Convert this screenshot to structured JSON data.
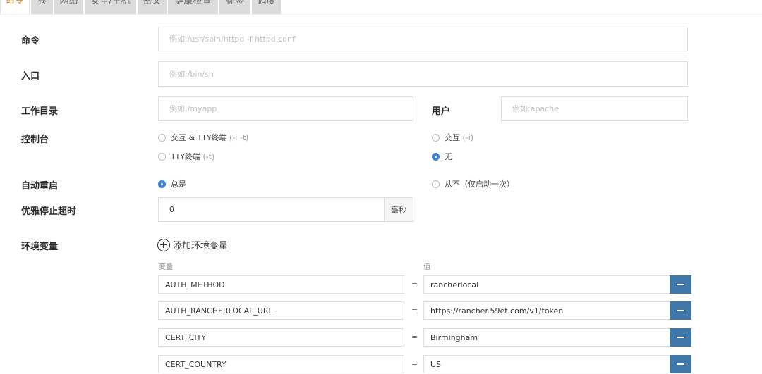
{
  "tabs": [
    {
      "label": "命令",
      "active": true
    },
    {
      "label": "卷",
      "active": false
    },
    {
      "label": "网络",
      "active": false
    },
    {
      "label": "安全/主机",
      "active": false
    },
    {
      "label": "密文",
      "active": false
    },
    {
      "label": "健康检查",
      "active": false
    },
    {
      "label": "标签",
      "active": false
    },
    {
      "label": "调度",
      "active": false
    }
  ],
  "command": {
    "label": "命令",
    "placeholder": "例如:/usr/sbin/httpd -f httpd.conf",
    "value": ""
  },
  "entrypoint": {
    "label": "入口",
    "placeholder": "例如:/bin/sh",
    "value": ""
  },
  "workdir": {
    "label": "工作目录",
    "placeholder": "例如:/myapp",
    "value": ""
  },
  "user": {
    "label": "用户",
    "placeholder": "例如:apache",
    "value": ""
  },
  "console": {
    "label": "控制台",
    "options": [
      {
        "text": "交互 & TTY终端",
        "hint": "(-i -t)",
        "selected": false
      },
      {
        "text": "交互",
        "hint": "(-i)",
        "selected": false
      },
      {
        "text": "TTY终端",
        "hint": "(-t)",
        "selected": false
      },
      {
        "text": "无",
        "hint": "",
        "selected": true
      }
    ]
  },
  "restart": {
    "label": "自动重启",
    "options": [
      {
        "text": "总是",
        "selected": true
      },
      {
        "text": "从不（仅启动一次）",
        "selected": false
      }
    ]
  },
  "stop_timeout": {
    "label": "优雅停止超时",
    "value": "0",
    "unit": "毫秒"
  },
  "env": {
    "label": "环境变量",
    "add_label": "添加环境变量",
    "key_header": "变量",
    "value_header": "值",
    "eq": "=",
    "rows": [
      {
        "key": "AUTH_METHOD",
        "value": "rancherlocal"
      },
      {
        "key": "AUTH_RANCHERLOCAL_URL",
        "value": "https://rancher.59et.com/v1/token"
      },
      {
        "key": "CERT_CITY",
        "value": "Birmingham"
      },
      {
        "key": "CERT_COUNTRY",
        "value": "US"
      }
    ]
  },
  "colors": {
    "accent": "#3f83d6",
    "remove_button": "#3f78a8",
    "active_tab": "#d98a2b",
    "tab_bg": "#dcdcdc"
  }
}
